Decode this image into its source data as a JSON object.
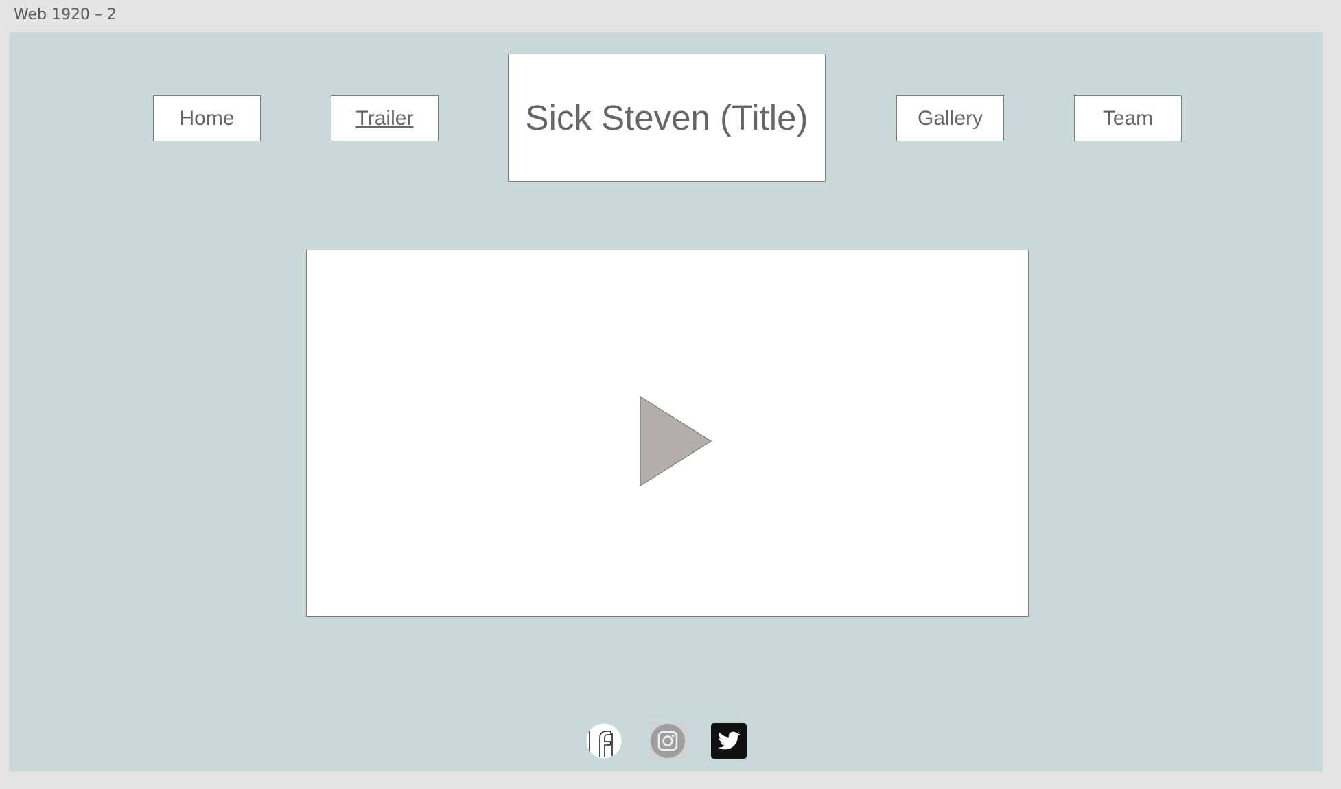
{
  "artboard": {
    "label": "Web 1920 – 2"
  },
  "nav": {
    "home": "Home",
    "trailer": "Trailer",
    "title": "Sick Steven (Title)",
    "gallery": "Gallery",
    "team": "Team"
  },
  "video": {
    "icon": "play-icon"
  },
  "social": {
    "icons": [
      "facebook-icon",
      "instagram-icon",
      "twitter-icon"
    ]
  },
  "colors": {
    "canvas_background": "#e4e4e4",
    "page_background": "#c9d8d9",
    "box_fill": "#ffffff",
    "box_border": "#7a7a7a",
    "text": "#666666",
    "play_fill": "#b4aeae"
  }
}
